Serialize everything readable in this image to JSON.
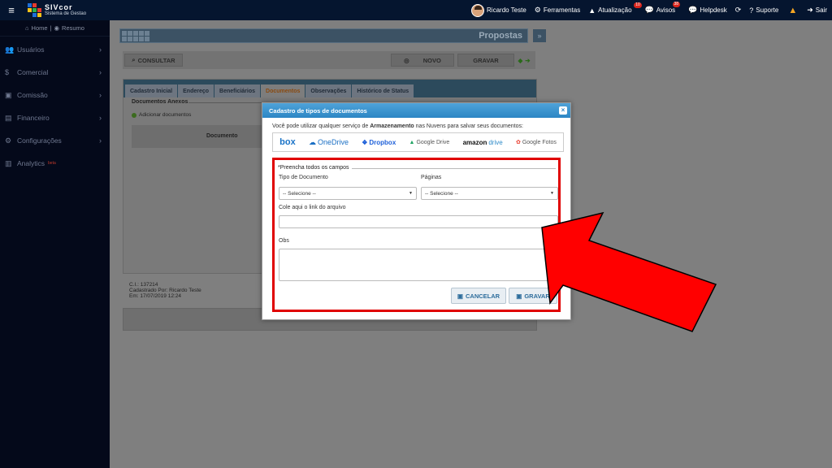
{
  "app": {
    "name": "SIVcor",
    "subtitle": "Sistema de Gestao"
  },
  "topnav": {
    "user": "Ricardo Teste",
    "ferramentas": "Ferramentas",
    "atualizacao": "Atualização",
    "atualizacao_badge": "10",
    "avisos": "Avisos",
    "avisos_badge": "38",
    "helpdesk": "Helpdesk",
    "suporte": "Suporte",
    "sair": "Sair"
  },
  "sidebar": {
    "home": "Home",
    "resumo": "Resumo",
    "items": [
      {
        "label": "Usuários",
        "icon": "users-icon"
      },
      {
        "label": "Comercial",
        "icon": "dollar-icon"
      },
      {
        "label": "Comissão",
        "icon": "money-icon"
      },
      {
        "label": "Financeiro",
        "icon": "briefcase-icon"
      },
      {
        "label": "Configurações",
        "icon": "gears-icon"
      },
      {
        "label": "Analytics",
        "icon": "chart-icon",
        "badge": "beta"
      }
    ]
  },
  "page": {
    "title": "Propostas"
  },
  "toolbar": {
    "consultar": "CONSULTAR",
    "novo": "NOVO",
    "gravar": "GRAVAR"
  },
  "tabs": [
    "Cadastro Inicial",
    "Endereço",
    "Beneficiários",
    "Documentos",
    "Observações",
    "Histórico de Status"
  ],
  "documents": {
    "legend": "Documentos Anexos",
    "add": "Adicionar documentos",
    "col": "Documento"
  },
  "info": {
    "ci": "C.I.: 137214",
    "cadastrado": "Cadastrado Por: Ricardo Teste",
    "em": "Em: 17/07/2019 12:24"
  },
  "modal": {
    "title": "Cadastro de tipos de documentos",
    "intro_pre": "Você pode utilizar qualquer serviço de ",
    "intro_bold": "Armazenamento",
    "intro_post": " nas Nuvens para salvar seus documentos:",
    "providers": {
      "box": "box",
      "onedrive": "OneDrive",
      "dropbox": "Dropbox",
      "gdrive": "Google Drive",
      "amazon_a": "amazon",
      "amazon_b": "drive",
      "gfotos": "Google Fotos"
    },
    "fieldset_legend": "*Preencha todos os campos",
    "tipo_label": "Tipo de Documento",
    "tipo_value": "-- Selecione --",
    "paginas_label": "Páginas",
    "paginas_value": "-- Selecione --",
    "link_label": "Cole aqui o link do arquivo",
    "obs_label": "Obs",
    "cancel": "CANCELAR",
    "save": "GRAVAR"
  },
  "colors": {
    "topbar": "#05152f",
    "modal_header": "#2c86c4",
    "highlight": "#e00000"
  }
}
